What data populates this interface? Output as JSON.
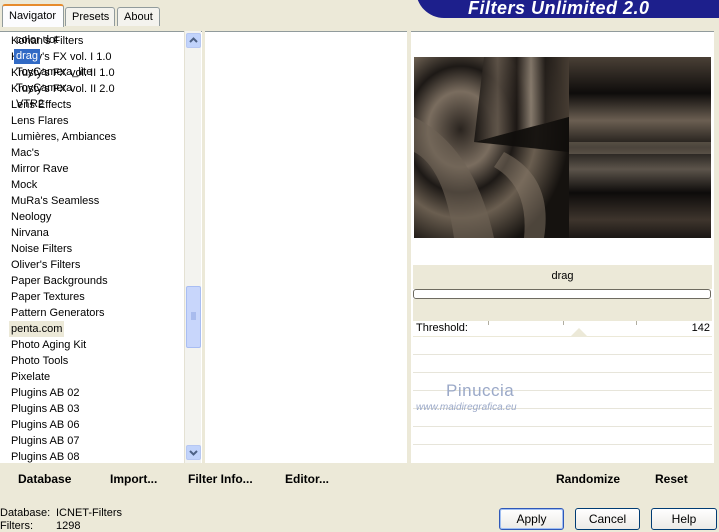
{
  "tabs": [
    {
      "label": "Navigator",
      "active": true
    },
    {
      "label": "Presets",
      "active": false
    },
    {
      "label": "About",
      "active": false
    }
  ],
  "brand_title": "Filters Unlimited 2.0",
  "categories": [
    "Kohan's Filters",
    "Krusty's FX vol. I 1.0",
    "Krusty's FX vol. II 1.0",
    "Krusty's FX vol. II 2.0",
    "Lens Effects",
    "Lens Flares",
    "Lumières, Ambiances",
    "Mac's",
    "Mirror Rave",
    "Mock",
    "MuRa's Seamless",
    "Neology",
    "Nirvana",
    "Noise Filters",
    "Oliver's Filters",
    "Paper Backgrounds",
    "Paper Textures",
    "Pattern Generators",
    "penta.com",
    "Photo Aging Kit",
    "Photo Tools",
    "Pixelate",
    "Plugins AB 02",
    "Plugins AB 03",
    "Plugins AB 06",
    "Plugins AB 07",
    "Plugins AB 08"
  ],
  "selected_category": "penta.com",
  "filters": [
    "color dot",
    "drag",
    "ToyCamera_lite",
    "ToyCamera",
    "VTR2"
  ],
  "selected_filter": "drag",
  "preview_filter_name": "drag",
  "parameter": {
    "label": "Threshold:",
    "value": "142"
  },
  "watermark": {
    "name": "Pinuccia",
    "url": "www.maidiregrafica.eu"
  },
  "bottom_buttons": {
    "database": "Database",
    "import": "Import...",
    "filter_info": "Filter Info...",
    "editor": "Editor...",
    "randomize": "Randomize",
    "reset": "Reset"
  },
  "status": {
    "database_label": "Database:",
    "database_value": "ICNET-Filters",
    "filters_label": "Filters:",
    "filters_value": "1298"
  },
  "dialog_buttons": {
    "apply": "Apply",
    "cancel": "Cancel",
    "help": "Help"
  },
  "colors": {
    "accent_selection": "#316ac5",
    "brand_bar": "#1d1f8c",
    "window_bg": "#ece9d8"
  }
}
